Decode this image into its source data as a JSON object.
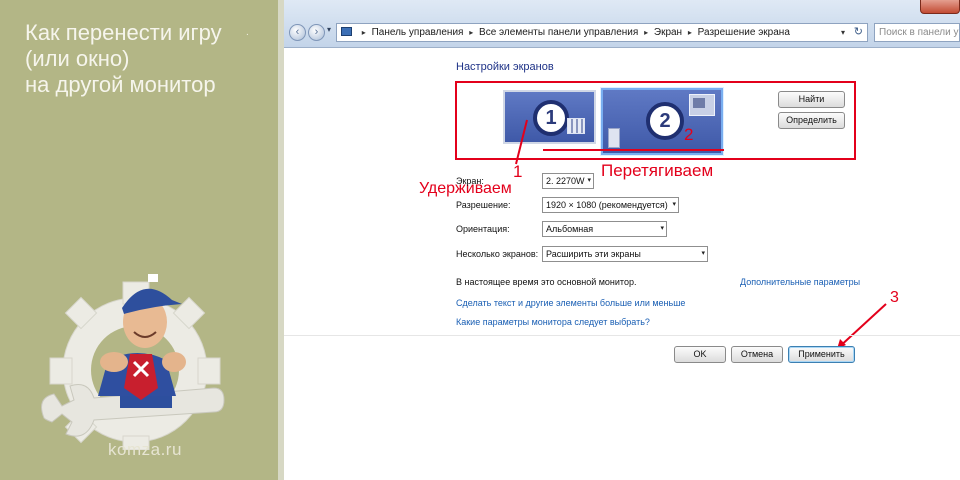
{
  "article": {
    "title_lines": [
      "Как перенести игру",
      "(или окно)",
      "на другой монитор"
    ],
    "dot": ".",
    "site": "komza.ru"
  },
  "window": {
    "nav": {
      "back": "‹",
      "forward": "›",
      "dropdown": "▾"
    },
    "breadcrumbs": [
      "Панель управления",
      "Все элементы панели управления",
      "Экран",
      "Разрешение экрана"
    ],
    "breadcrumb_sep": "▸",
    "address_dropdown": "▾",
    "refresh": "↻",
    "search_placeholder": "Поиск в панели управления"
  },
  "display": {
    "section_title": "Настройки экранов",
    "monitors": [
      {
        "number": "1"
      },
      {
        "number": "2"
      }
    ],
    "find_button": "Найти",
    "identify_button": "Определить",
    "fields": {
      "screen": {
        "label": "Экран:",
        "value": "2. 2270W"
      },
      "resolution": {
        "label": "Разрешение:",
        "value": "1920 × 1080 (рекомендуется)"
      },
      "orientation": {
        "label": "Ориентация:",
        "value": "Альбомная"
      },
      "multiple": {
        "label": "Несколько экранов:",
        "value": "Расширить эти экраны"
      }
    },
    "select_arrow": "▾",
    "info_text": "В настоящее время это основной монитор.",
    "advanced_link": "Дополнительные параметры",
    "links": {
      "text_size": "Сделать текст и другие элементы больше или меньше",
      "monitor_params": "Какие параметры монитора следует выбрать?"
    },
    "buttons": {
      "ok": "OK",
      "cancel": "Отмена",
      "apply": "Применить"
    }
  },
  "annotations": {
    "step1": "1",
    "hold": "Удерживаем",
    "drag": "Перетягиваем",
    "step2": "2",
    "step3": "3",
    "color": "#e3001b"
  },
  "colors": {
    "panel_bg": "#b3b686",
    "monitor_blue": "#4e68b7",
    "link_blue": "#1a5fb4"
  }
}
